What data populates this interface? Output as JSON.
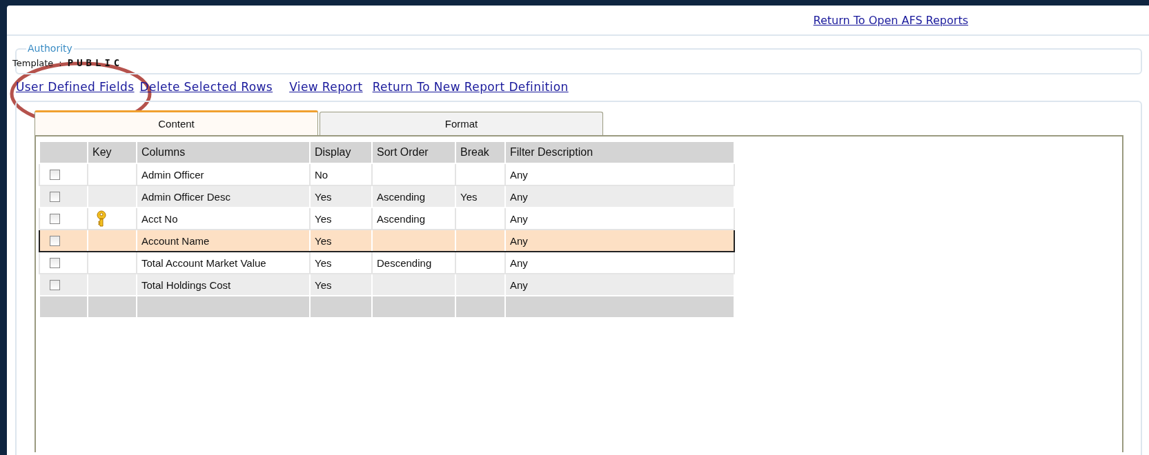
{
  "top_link": "Return To Open AFS Reports",
  "authority": {
    "legend": "Authority",
    "template_label": "Template",
    "separator": ":",
    "template_value": "PUBLIC"
  },
  "actions": [
    "User Defined Fields",
    "Delete Selected Rows",
    "View Report",
    "Return To New Report Definition"
  ],
  "annotation": {
    "kind": "ellipse",
    "color": "#b5524c"
  },
  "tabs": [
    {
      "label": "Content",
      "selected": true
    },
    {
      "label": "Format",
      "selected": false
    }
  ],
  "table": {
    "columns": [
      "Key",
      "Columns",
      "Display",
      "Sort Order",
      "Break",
      "Filter Description"
    ],
    "rows": [
      {
        "checked": false,
        "key": false,
        "selected": false,
        "column": "Admin Officer",
        "display": "No",
        "sort_order": "",
        "break": "",
        "filter": "Any"
      },
      {
        "checked": false,
        "key": false,
        "selected": false,
        "column": "Admin Officer Desc",
        "display": "Yes",
        "sort_order": "Ascending",
        "break": "Yes",
        "filter": "Any"
      },
      {
        "checked": false,
        "key": true,
        "selected": false,
        "column": "Acct No",
        "display": "Yes",
        "sort_order": "Ascending",
        "break": "",
        "filter": "Any"
      },
      {
        "checked": false,
        "key": false,
        "selected": true,
        "column": "Account Name",
        "display": "Yes",
        "sort_order": "",
        "break": "",
        "filter": "Any"
      },
      {
        "checked": false,
        "key": false,
        "selected": false,
        "column": "Total Account Market Value",
        "display": "Yes",
        "sort_order": "Descending",
        "break": "",
        "filter": "Any"
      },
      {
        "checked": false,
        "key": false,
        "selected": false,
        "column": "Total Holdings Cost",
        "display": "Yes",
        "sort_order": "",
        "break": "",
        "filter": "Any"
      }
    ]
  }
}
